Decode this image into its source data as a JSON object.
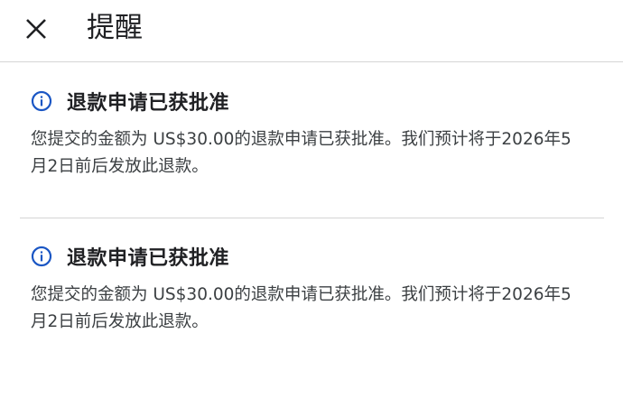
{
  "header": {
    "close_icon": "close-icon",
    "title": "提醒"
  },
  "notices": [
    {
      "icon": "info-icon",
      "title": "退款申请已获批准",
      "body": "您提交的金额为 US$30.00的退款申请已获批准。我们预计将于2026年5月2日前后发放此退款。"
    },
    {
      "icon": "info-icon",
      "title": "退款申请已获批准",
      "body": "您提交的金额为 US$30.00的退款申请已获批准。我们预计将于2026年5月2日前后发放此退款。"
    }
  ],
  "colors": {
    "info_icon": "#1a56c4",
    "divider": "#d5d5d5",
    "text_primary": "#202124",
    "text_secondary": "#3c4043"
  }
}
